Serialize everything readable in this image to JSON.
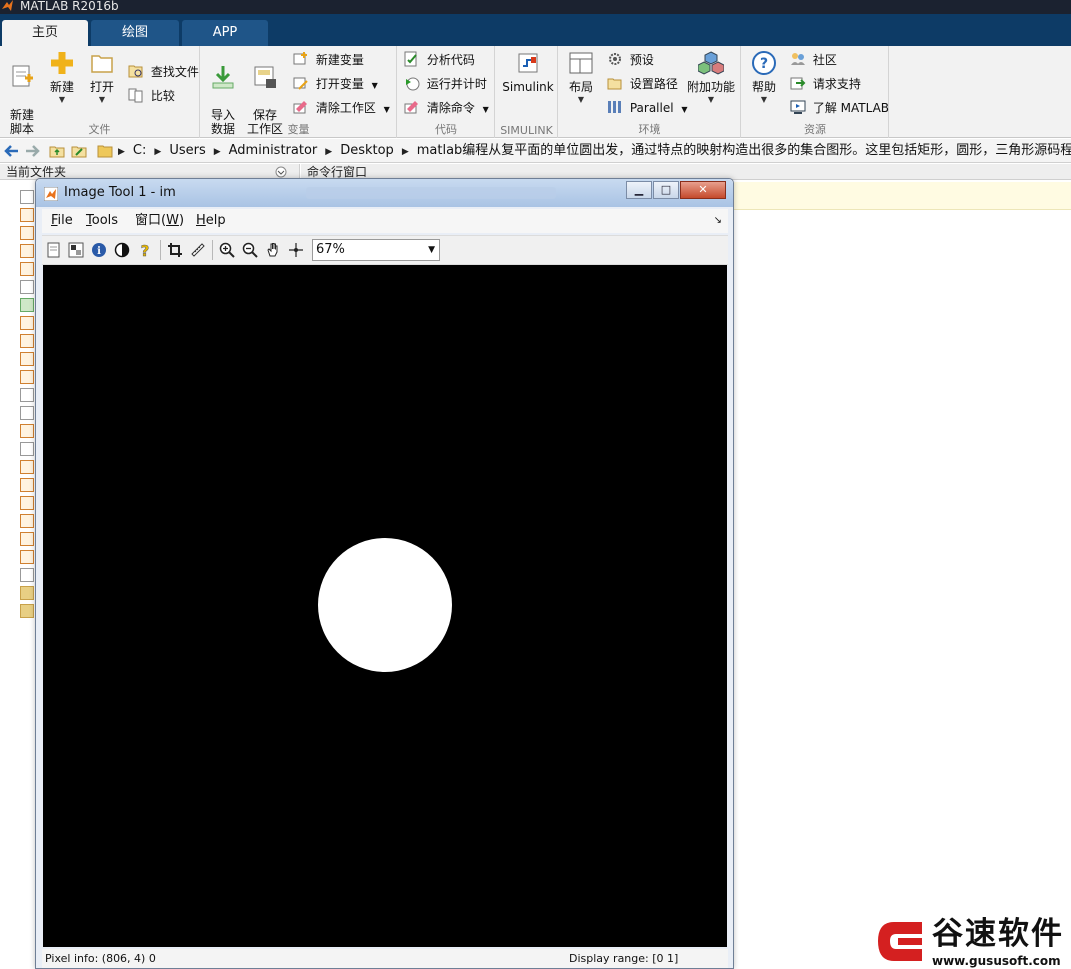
{
  "app": {
    "title": "MATLAB R2016b",
    "tabs": [
      {
        "label": "主页",
        "active": true
      },
      {
        "label": "绘图",
        "active": false
      },
      {
        "label": "APP",
        "active": false
      }
    ]
  },
  "ribbon": {
    "file": {
      "group_label": "文件",
      "new_script": "新建\n脚本",
      "new": "新建",
      "open": "打开",
      "find_files": "查找文件",
      "compare": "比较"
    },
    "variable": {
      "group_label": "变量",
      "import_data": "导入\n数据",
      "save_workspace": "保存\n工作区",
      "new_variable": "新建变量",
      "open_variable": "打开变量",
      "clear_workspace": "清除工作区"
    },
    "code": {
      "group_label": "代码",
      "analyze_code": "分析代码",
      "run_and_time": "运行并计时",
      "clear_commands": "清除命令"
    },
    "simulink": {
      "group_label": "SIMULINK",
      "simulink": "Simulink"
    },
    "environment": {
      "group_label": "环境",
      "layout": "布局",
      "preferences": "预设",
      "set_path": "设置路径",
      "parallel": "Parallel",
      "addons": "附加功能"
    },
    "resources": {
      "group_label": "资源",
      "help": "帮助",
      "community": "社区",
      "request_support": "请求支持",
      "learn_matlab": "了解 MATLAB"
    }
  },
  "address": {
    "crumbs": [
      "C:",
      "Users",
      "Administrator",
      "Desktop",
      "matlab编程从复平面的单位圆出发，通过特点的映射构造出很多的集合图形。这里包括矩形，圆形，三角形源码程序"
    ]
  },
  "panels": {
    "current_folder": "当前文件夹",
    "command_window": "命令行窗口"
  },
  "image_tool": {
    "title": "Image Tool 1 - im",
    "menu": {
      "file": "File",
      "tools": "Tools",
      "window": "窗口(W)",
      "help": "Help"
    },
    "zoom_value": "67%",
    "status": {
      "pixel_info": "Pixel info: (806, 4)  0",
      "display_range": "Display range: [0 1]"
    },
    "colors": {
      "background": "#000000",
      "disk": "#ffffff"
    }
  },
  "watermark": {
    "brand": "谷速软件",
    "url": "www.gususoft.com",
    "color": "#d42020"
  }
}
